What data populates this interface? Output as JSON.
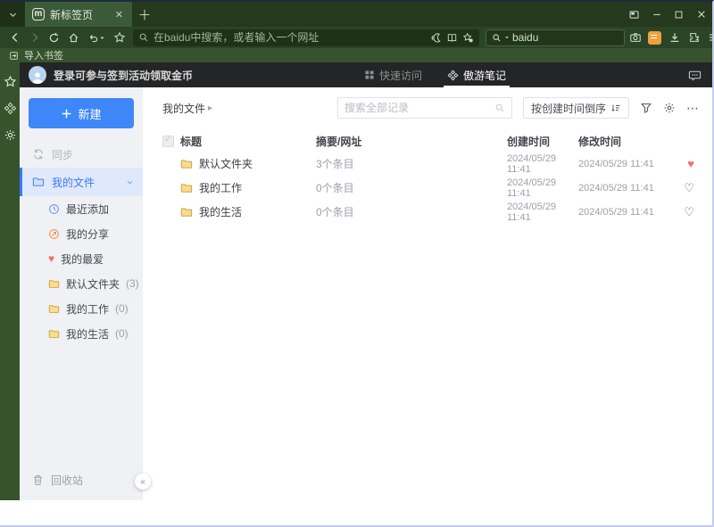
{
  "colors": {
    "theme_green_dark": "#24391e",
    "theme_green_toolbar": "#2b4425",
    "theme_green_light": "#36532d",
    "accent_blue": "#3e87f8",
    "favorite_red": "#f56c6c",
    "folder_yellow": "#f5c95a",
    "note_amber": "#efa23b",
    "app_header_dark": "#242526"
  },
  "icons": {
    "tab_list": "chevron-down",
    "browser_logo": "m-badge",
    "address_search": "magnifier",
    "read_aloud": "crescent-with-waves",
    "reading_mode": "open-book",
    "bookmark_star_gear": "star-gear",
    "screenshot": "camera",
    "notes_shortcut": "amber-note",
    "download": "down-arrow-tray",
    "extensions": "puzzle",
    "menu": "hamburger",
    "sort": "list-with-arrow",
    "filter": "funnel",
    "settings": "gear",
    "notes_app": "pinwheel"
  },
  "browser": {
    "tab": {
      "title": "新标签页"
    },
    "address_bar": {
      "placeholder": "在baidu中搜索，或者输入一个网址"
    },
    "search_box": {
      "value": "baidu"
    },
    "bookmarks_bar": {
      "import_label": "导入书签"
    }
  },
  "page": {
    "header": {
      "login_text": "登录可参与签到活动领取金币",
      "tabs": [
        {
          "label": "快速访问"
        },
        {
          "label": "傲游笔记"
        }
      ]
    },
    "sidebar": {
      "new_button": "新建",
      "sync_label": "同步",
      "my_files_label": "我的文件",
      "items": [
        {
          "label": "最近添加"
        },
        {
          "label": "我的分享"
        },
        {
          "label": "我的最爱"
        },
        {
          "label": "默认文件夹",
          "count": "(3)"
        },
        {
          "label": "我的工作",
          "count": "(0)"
        },
        {
          "label": "我的生活",
          "count": "(0)"
        }
      ],
      "recycle_bin": "回收站"
    },
    "main": {
      "breadcrumb": "我的文件",
      "search_placeholder": "搜索全部记录",
      "sort_button": "按创建时间倒序",
      "table": {
        "headers": [
          "标题",
          "摘要/网址",
          "创建时间",
          "修改时间"
        ],
        "rows": [
          {
            "title": "默认文件夹",
            "summary": "3个条目",
            "created": "2024/05/29 11:41",
            "modified": "2024/05/29 11:41"
          },
          {
            "title": "我的工作",
            "summary": "0个条目",
            "created": "2024/05/29 11:41",
            "modified": "2024/05/29 11:41"
          },
          {
            "title": "我的生活",
            "summary": "0个条目",
            "created": "2024/05/29 11:41",
            "modified": "2024/05/29 11:41"
          }
        ]
      }
    }
  }
}
